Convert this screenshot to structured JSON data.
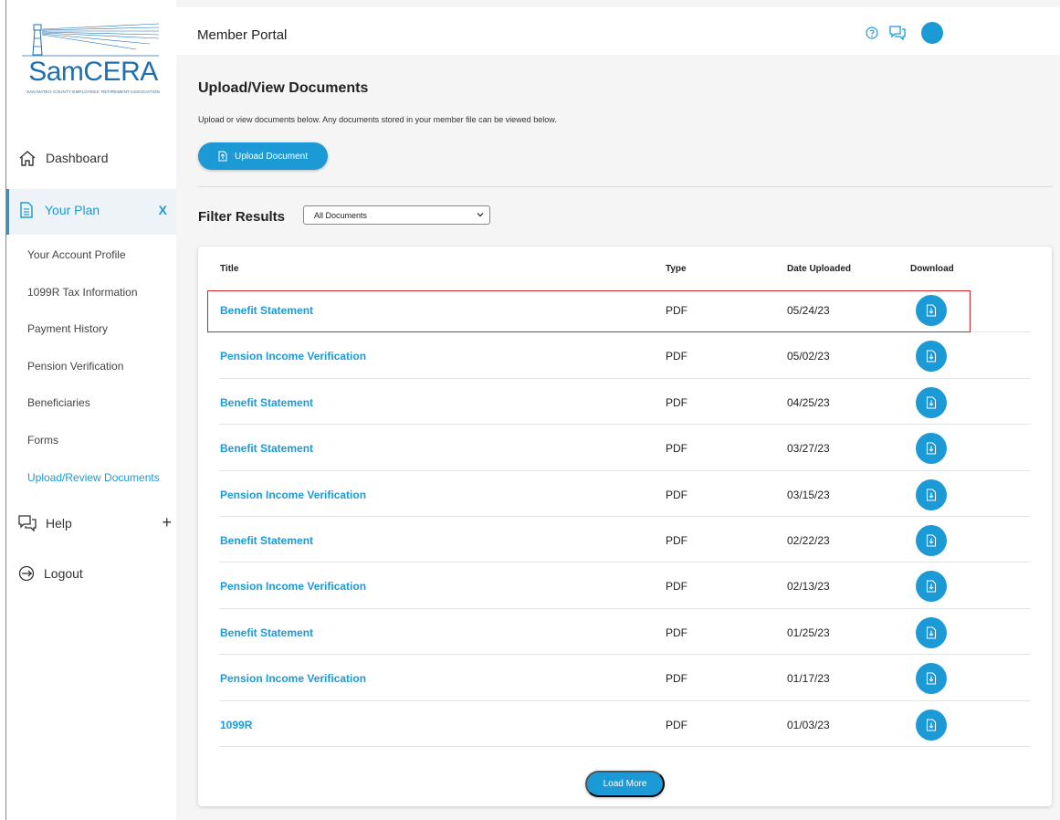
{
  "brand": {
    "logo_word_sam": "Sam",
    "logo_word_cera": "CERA",
    "logo_subtitle": "SAN MATEO COUNTY EMPLOYEES' RETIREMENT ASSOCIATION",
    "accent_color": "#1c9ad6"
  },
  "sidebar": {
    "dashboard_label": "Dashboard",
    "plan_label": "Your Plan",
    "plan_collapse": "X",
    "sub_items": [
      "Your Account Profile",
      "1099R Tax Information",
      "Payment History",
      "Pension Verification",
      "Beneficiaries",
      "Forms",
      "Upload/Review Documents"
    ],
    "active_sub_item": "Upload/Review Documents",
    "help_label": "Help",
    "help_expand": "+",
    "logout_label": "Logout"
  },
  "header": {
    "title": "Member Portal",
    "icons": [
      "help-icon",
      "chat-icon",
      "avatar"
    ]
  },
  "page": {
    "heading": "Upload/View Documents",
    "description": "Upload or view documents below. Any documents stored in your member file can be viewed below.",
    "upload_button": "Upload Document",
    "filter_label": "Filter Results",
    "filter_selected": "All Documents"
  },
  "table": {
    "columns": [
      "Title",
      "Type",
      "Date Uploaded",
      "Download"
    ],
    "rows": [
      {
        "title": "Benefit Statement",
        "type": "PDF",
        "date": "05/24/23"
      },
      {
        "title": "Pension Income Verification",
        "type": "PDF",
        "date": "05/02/23"
      },
      {
        "title": "Benefit Statement",
        "type": "PDF",
        "date": "04/25/23"
      },
      {
        "title": "Benefit Statement",
        "type": "PDF",
        "date": "03/27/23"
      },
      {
        "title": "Pension Income Verification",
        "type": "PDF",
        "date": "03/15/23"
      },
      {
        "title": "Benefit Statement",
        "type": "PDF",
        "date": "02/22/23"
      },
      {
        "title": "Pension Income Verification",
        "type": "PDF",
        "date": "02/13/23"
      },
      {
        "title": "Benefit Statement",
        "type": "PDF",
        "date": "01/25/23"
      },
      {
        "title": "Pension Income Verification",
        "type": "PDF",
        "date": "01/17/23"
      },
      {
        "title": "1099R",
        "type": "PDF",
        "date": "01/03/23"
      }
    ],
    "load_more": "Load More"
  }
}
